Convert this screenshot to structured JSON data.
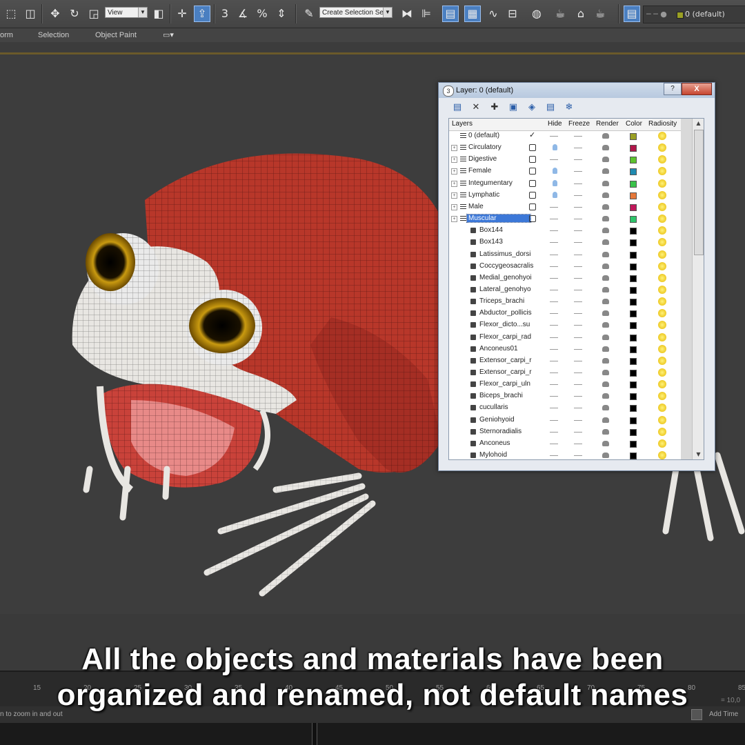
{
  "toolbar": {
    "view_dropdown": "View",
    "selection_set_dropdown": "Create Selection Se",
    "layer_current": "0 (default)",
    "snap_labels": [
      "3",
      "%"
    ]
  },
  "ribbon": {
    "items": [
      "orm",
      "Selection",
      "Object Paint"
    ]
  },
  "dialog": {
    "title": "Layer: 0 (default)",
    "help_button": "?",
    "close_button": "X",
    "columns": {
      "layers": "Layers",
      "hide": "Hide",
      "freeze": "Freeze",
      "render": "Render",
      "color": "Color",
      "radiosity": "Radiosity"
    },
    "rows": [
      {
        "name": "0 (default)",
        "kind": "layer",
        "expandable": false,
        "current": true,
        "hidden_bulb": false,
        "color": "#9aa024"
      },
      {
        "name": "Circulatory",
        "kind": "layer",
        "expandable": true,
        "current": false,
        "hidden_bulb": true,
        "color": "#b0164a"
      },
      {
        "name": "Digestive",
        "kind": "layer",
        "expandable": true,
        "current": false,
        "hidden_bulb": false,
        "color": "#5dc22e"
      },
      {
        "name": "Female",
        "kind": "layer",
        "expandable": true,
        "current": false,
        "hidden_bulb": true,
        "color": "#1f8ab0"
      },
      {
        "name": "Integumentary",
        "kind": "layer",
        "expandable": true,
        "current": false,
        "hidden_bulb": true,
        "color": "#39c24a"
      },
      {
        "name": "Lymphatic",
        "kind": "layer",
        "expandable": true,
        "current": false,
        "hidden_bulb": true,
        "color": "#e5783a"
      },
      {
        "name": "Male",
        "kind": "layer",
        "expandable": true,
        "current": false,
        "hidden_bulb": false,
        "color": "#c0185a"
      },
      {
        "name": "Muscular",
        "kind": "layer",
        "expandable": true,
        "current": false,
        "hidden_bulb": false,
        "color": "#2ec46a",
        "selected": true
      },
      {
        "name": "Box144",
        "kind": "object",
        "color": "#000000"
      },
      {
        "name": "Box143",
        "kind": "object",
        "color": "#000000"
      },
      {
        "name": "Latissimus_dorsi",
        "kind": "object",
        "color": "#000000"
      },
      {
        "name": "Coccygeosacralis",
        "kind": "object",
        "color": "#000000"
      },
      {
        "name": "Medial_genohyoi",
        "kind": "object",
        "color": "#000000"
      },
      {
        "name": "Lateral_genohyo",
        "kind": "object",
        "color": "#000000"
      },
      {
        "name": "Triceps_brachi",
        "kind": "object",
        "color": "#000000"
      },
      {
        "name": "Abductor_pollicis",
        "kind": "object",
        "color": "#000000"
      },
      {
        "name": "Flexor_dicto...su",
        "kind": "object",
        "color": "#000000"
      },
      {
        "name": "Flexor_carpi_rad",
        "kind": "object",
        "color": "#000000"
      },
      {
        "name": "Anconeus01",
        "kind": "object",
        "color": "#000000"
      },
      {
        "name": "Extensor_carpi_r",
        "kind": "object",
        "color": "#000000"
      },
      {
        "name": "Extensor_carpi_r",
        "kind": "object",
        "color": "#000000"
      },
      {
        "name": "Flexor_carpi_uln",
        "kind": "object",
        "color": "#000000"
      },
      {
        "name": "Biceps_brachi",
        "kind": "object",
        "color": "#000000"
      },
      {
        "name": "cucullaris",
        "kind": "object",
        "color": "#000000"
      },
      {
        "name": "Geniohyoid",
        "kind": "object",
        "color": "#000000"
      },
      {
        "name": "Sternoradialis",
        "kind": "object",
        "color": "#000000"
      },
      {
        "name": "Anconeus",
        "kind": "object",
        "color": "#000000"
      },
      {
        "name": "Mylohoid",
        "kind": "object",
        "color": "#000000"
      }
    ]
  },
  "caption": {
    "line1": "All the objects and materials have been",
    "line2": "organized and renamed, not default names"
  },
  "timeline": {
    "ticks": [
      "15",
      "20",
      "25",
      "30",
      "35",
      "40",
      "45",
      "50",
      "55",
      "60",
      "65",
      "70",
      "75",
      "80",
      "85"
    ]
  },
  "statusbar": {
    "hint": "n to zoom in and out",
    "add_time_tag": "Add Time Ta",
    "coord": "= 10,0"
  }
}
